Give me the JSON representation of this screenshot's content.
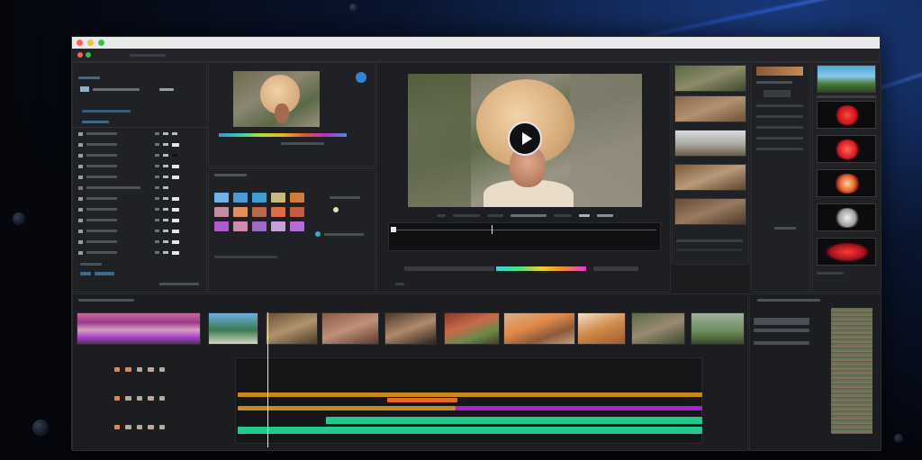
{
  "window": {
    "title": "",
    "panels": {
      "project": "",
      "effects": "",
      "timeline": "",
      "mixer": ""
    }
  },
  "program": {
    "play_icon": "play-icon"
  },
  "colors": {
    "accent_orange": "#e36a2a",
    "accent_gold": "#c98a1c",
    "accent_purple": "#b01ed8",
    "accent_green": "#22c98c",
    "effect_red": "#d8141e"
  }
}
